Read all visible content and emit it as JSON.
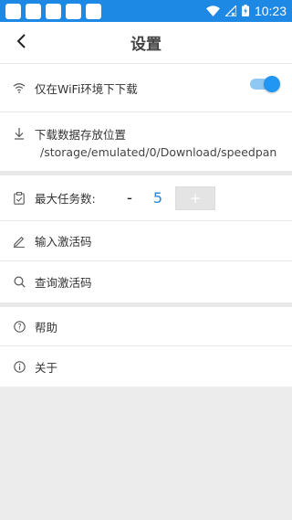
{
  "status_bar": {
    "time": "10:23",
    "notification_icons": [
      "notification-icon",
      "notification-icon",
      "notification-icon",
      "notification-icon",
      "notification-icon"
    ],
    "system_icons": [
      "wifi-icon",
      "signal-off-icon",
      "battery-charging-icon"
    ],
    "color": "#1e88e5"
  },
  "header": {
    "title": "设置",
    "back_icon": "chevron-left-icon"
  },
  "download": {
    "wifi_only_label": "仅在WiFi环境下下载",
    "wifi_only_enabled": true,
    "storage_label": "下载数据存放位置",
    "storage_path": "/storage/emulated/0/Download/speedpan"
  },
  "tasks": {
    "max_tasks_label": "最大任务数:",
    "minus_label": "-",
    "max_tasks_value": "5",
    "plus_label": "+",
    "enter_code_label": "输入激活码",
    "query_code_label": "查询激活码"
  },
  "about": {
    "help_label": "帮助",
    "about_label": "关于"
  },
  "accent_color": "#2196f3"
}
